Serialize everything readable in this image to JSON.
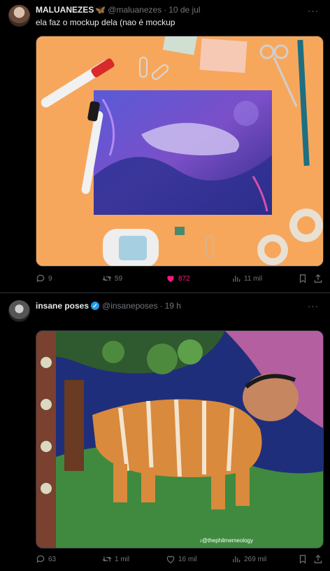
{
  "tweets": [
    {
      "name": "MALUANEZES",
      "name_emoji": "🦋",
      "handle": "@maluanezes",
      "time": "10 de jul",
      "text": "ela faz o mockup dela (nao é mockup",
      "replies": "9",
      "retweets": "59",
      "likes": "872",
      "views": "11 mil",
      "liked": true
    },
    {
      "name": "insane poses",
      "verified": true,
      "handle": "@insaneposes",
      "time": "19 h",
      "watermark": "@thephilmemeology",
      "replies": "63",
      "retweets": "1 mil",
      "likes": "16 mil",
      "views": "269 mil",
      "liked": false
    }
  ],
  "colors": {
    "like_active": "#f91880",
    "verified": "#1d9bf0",
    "muted": "#71767b"
  },
  "icons": [
    "reply-icon",
    "retweet-icon",
    "heart-icon",
    "views-icon",
    "bookmark-icon",
    "share-icon",
    "more-icon",
    "verified-icon"
  ]
}
